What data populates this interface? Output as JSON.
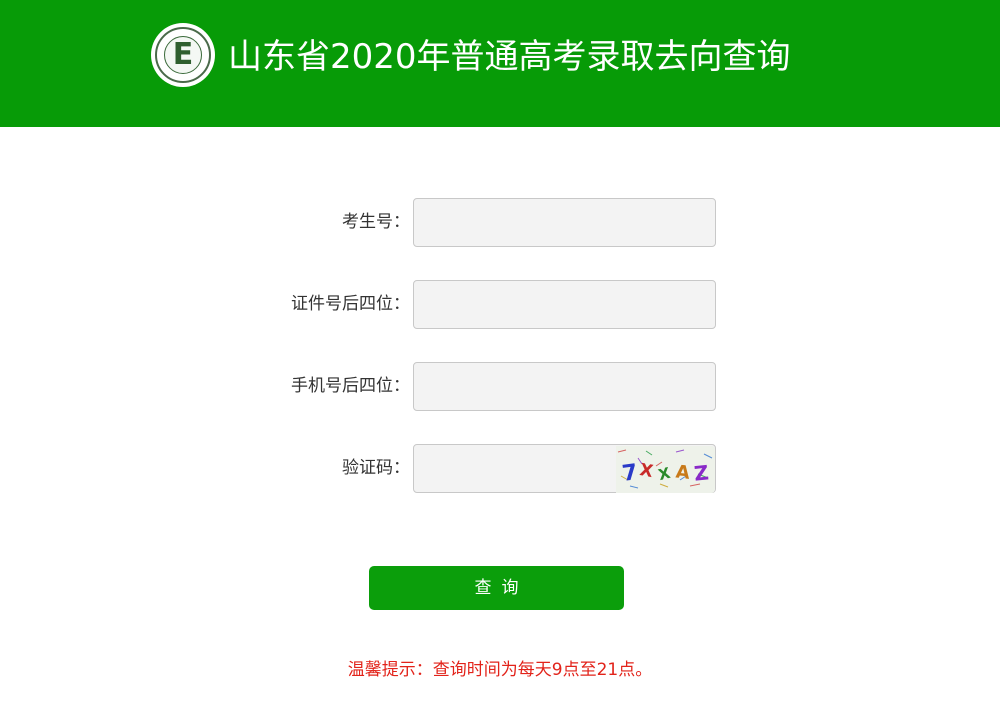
{
  "header": {
    "title": "山东省2020年普通高考录取去向查询",
    "logo_letter": "E",
    "logo_icon": "exam-authority-seal-icon",
    "background_color": "#079b07"
  },
  "form": {
    "fields": [
      {
        "label": "考生号：",
        "value": ""
      },
      {
        "label": "证件号后四位：",
        "value": ""
      },
      {
        "label": "手机号后四位：",
        "value": ""
      },
      {
        "label": "验证码：",
        "value": ""
      }
    ],
    "captcha": {
      "text": "7XXAZ",
      "icon": "captcha-image"
    },
    "submit_label": "查询",
    "button_color": "#0b9e0b"
  },
  "notice": {
    "text": "温馨提示：查询时间为每天9点至21点。",
    "color": "#e2231a"
  }
}
